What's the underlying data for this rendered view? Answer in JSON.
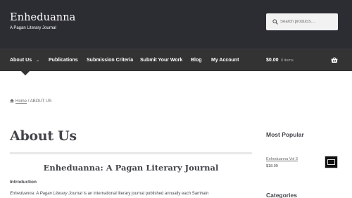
{
  "site": {
    "title": "Enheduanna",
    "tagline": "A Pagan Literary Journal"
  },
  "search": {
    "placeholder": "Search products…",
    "icon": "search-icon"
  },
  "nav": {
    "items": [
      {
        "label": "About Us",
        "icon": "chevron-down-icon"
      },
      {
        "label": "Publications"
      },
      {
        "label": "Submission Criteria"
      },
      {
        "label": "Submit Your Work"
      },
      {
        "label": "Blog"
      },
      {
        "label": "My Account"
      }
    ],
    "cart_total": "$0.00",
    "cart_count": "0 items",
    "cart_icon": "basket-icon"
  },
  "breadcrumb": {
    "home_label": "Home",
    "separator": " / ",
    "current": "ABOUT US",
    "icon": "home-icon"
  },
  "main": {
    "title": "About Us",
    "heading": "Enheduanna: A Pagan Literary Journal",
    "intro_label": "Introduction",
    "intro_em": "Enheduanna: A Pagan Literary Journal",
    "intro_rest": " is an international literary journal published annually each Samhain"
  },
  "sidebar": {
    "popular_title": "Most Popular",
    "product_name": "Enheduanna Vol 3",
    "product_price": "$18.99",
    "categories_title": "Categories"
  },
  "colors": {
    "header_bg": "#2c2d33",
    "nav_bg": "#333333",
    "text": "#43454b"
  }
}
